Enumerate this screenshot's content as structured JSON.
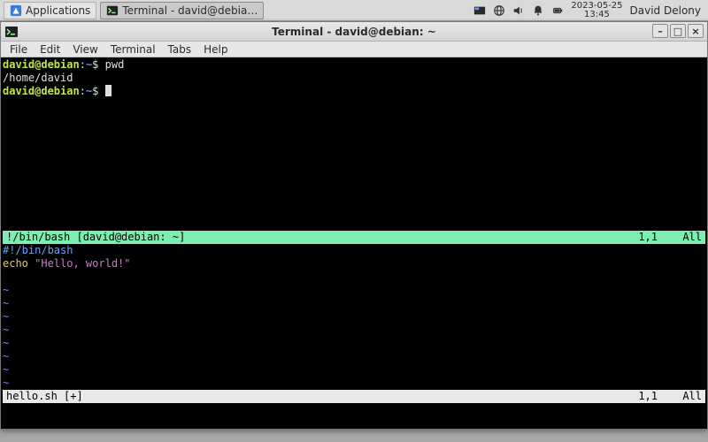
{
  "panel": {
    "applications_label": "Applications",
    "task_label": "Terminal - david@debia…",
    "clock_date": "2023-05-25",
    "clock_time": "13:45",
    "user_name": "David Delony"
  },
  "window": {
    "title": "Terminal - david@debian: ~",
    "menu_items": [
      "File",
      "Edit",
      "View",
      "Terminal",
      "Tabs",
      "Help"
    ]
  },
  "terminal": {
    "prompt_user": "david@debian",
    "prompt_sep1": ":",
    "prompt_path": "~",
    "prompt_sep2": "$ ",
    "cmd1": "pwd",
    "output1": "/home/david"
  },
  "vim": {
    "top_status_left": "!/bin/bash [david@debian: ~]",
    "top_status_pos": "1,1",
    "top_status_pct": "All",
    "line1_shebang": "#!/bin/bash",
    "line2_full": "echo \"Hello, world!\"",
    "line2_kw": "echo ",
    "line2_str": "\"Hello, world!\"",
    "tilde": "~",
    "bottom_status_left": "hello.sh [+]",
    "bottom_status_pos": "1,1",
    "bottom_status_pct": "All"
  }
}
